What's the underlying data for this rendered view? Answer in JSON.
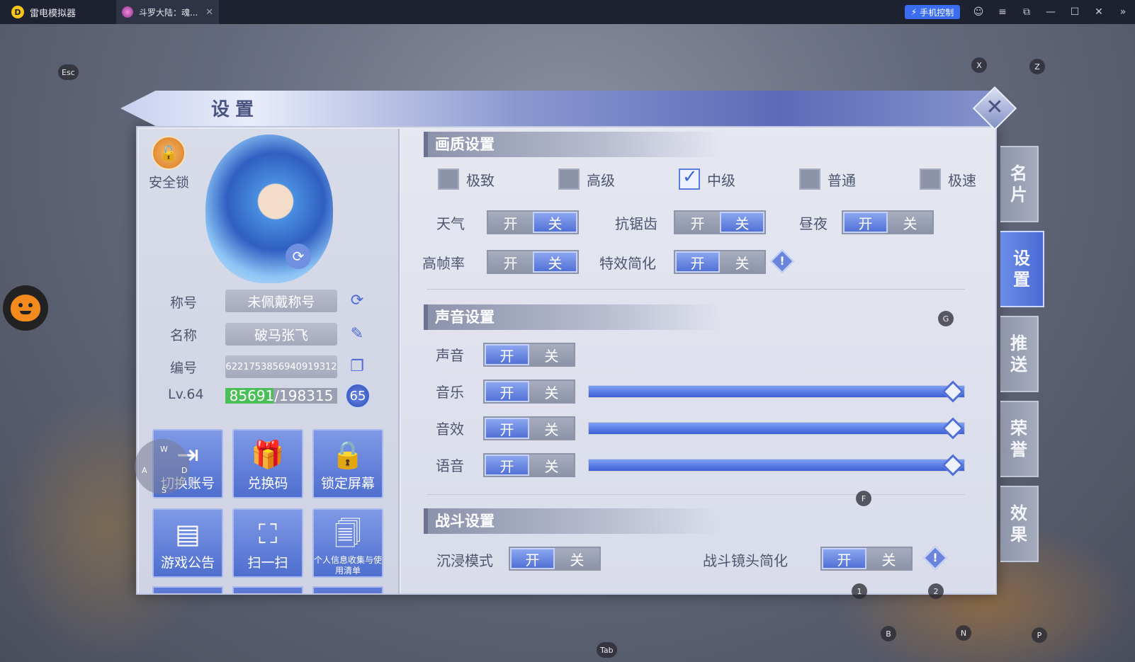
{
  "titlebar": {
    "app_name": "雷电模拟器",
    "tab_title": "斗罗大陆：魂...",
    "phone_control": "手机控制"
  },
  "key_hints": {
    "esc": "Esc",
    "x": "X",
    "z": "Z",
    "g": "G",
    "f": "F",
    "one": "1",
    "two": "2",
    "b": "B",
    "n": "N",
    "p": "P",
    "tab": "Tab",
    "joy_w": "W",
    "joy_a": "A",
    "joy_s": "S",
    "joy_d": "D"
  },
  "panel": {
    "title": "设置"
  },
  "profile": {
    "lock_label": "安全锁",
    "title_label": "称号",
    "title_value": "未佩戴称号",
    "name_label": "名称",
    "name_value": "破马张飞",
    "id_label": "编号",
    "id_value": "6221753856940919312",
    "level_label": "Lv.64",
    "xp_text": "85691/198315",
    "xp_current": 85691,
    "xp_max": 198315,
    "level_badge": "65"
  },
  "tiles": [
    {
      "label": "切换账号"
    },
    {
      "label": "兑换码"
    },
    {
      "label": "锁定屏幕"
    },
    {
      "label": "游戏公告"
    },
    {
      "label": "扫一扫"
    },
    {
      "label": "个人信息收集与使用清单"
    }
  ],
  "graphics": {
    "heading": "画质设置",
    "quality_options": [
      "极致",
      "高级",
      "中级",
      "普通",
      "极速"
    ],
    "quality_selected": "中级",
    "weather_label": "天气",
    "antialias_label": "抗锯齿",
    "daynight_label": "昼夜",
    "highfps_label": "高帧率",
    "effects_label": "特效简化",
    "on": "开",
    "off": "关"
  },
  "sound": {
    "heading": "声音设置",
    "sound_label": "声音",
    "music_label": "音乐",
    "sfx_label": "音效",
    "voice_label": "语音",
    "music_level": 1.0,
    "sfx_level": 1.0,
    "voice_level": 1.0
  },
  "battle": {
    "heading": "战斗设置",
    "immersive_label": "沉浸模式",
    "camera_label": "战斗镜头简化"
  },
  "side_tabs": [
    "名片",
    "设置",
    "推送",
    "荣誉",
    "效果"
  ],
  "colors": {
    "accent": "#4d6dd4",
    "xp_green": "#4bbf57",
    "brand_blue": "#3a6df0"
  }
}
